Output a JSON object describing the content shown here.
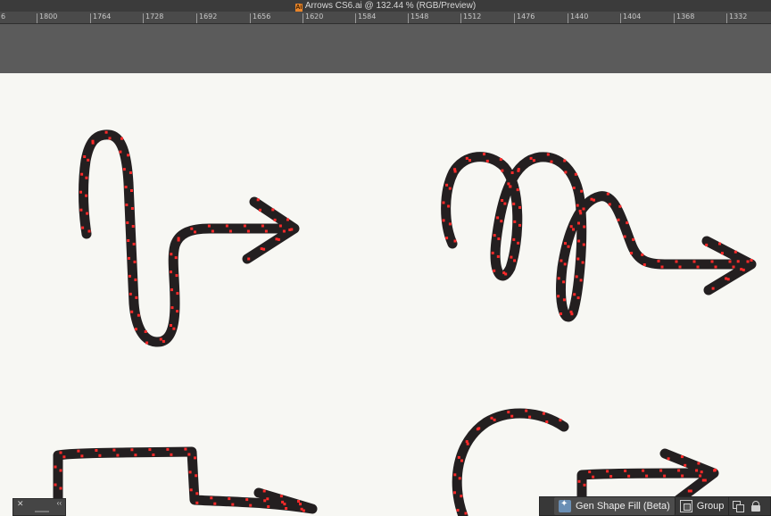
{
  "window": {
    "title": "Arrows CS6.ai @ 132.44 % (RGB/Preview)"
  },
  "ruler": {
    "ticks": [
      "6",
      "1800",
      "1764",
      "1728",
      "1692",
      "1656",
      "1620",
      "1584",
      "1548",
      "1512",
      "1476",
      "1440",
      "1404",
      "1368",
      "1332"
    ]
  },
  "colors": {
    "stroke": "#231f20",
    "anchor": "#ff2a2a",
    "artboard": "#f7f7f3",
    "pasteboard": "#5b5b5b"
  },
  "artwork": {
    "names": [
      "arrow-s-curve",
      "arrow-loops",
      "arrow-step",
      "arrow-arc"
    ]
  },
  "context_bar": {
    "gen_shape_fill_label": "Gen Shape Fill (Beta)",
    "group_label": "Group"
  },
  "mini_panel": {
    "close_icon": "close-icon",
    "collapse_label": "‹‹"
  }
}
